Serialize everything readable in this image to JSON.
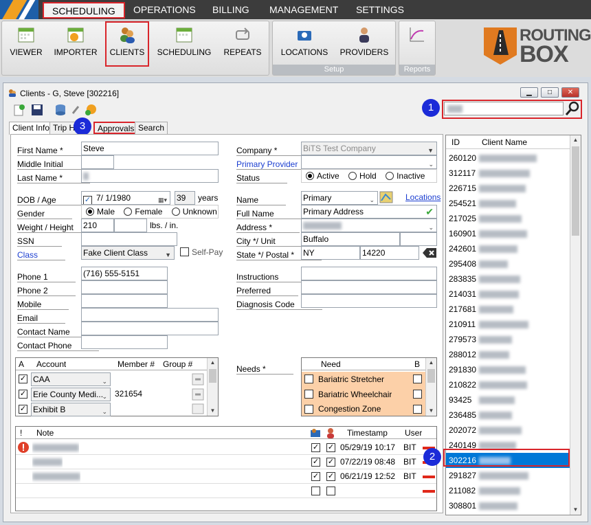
{
  "menu": {
    "items": [
      "SCHEDULING",
      "OPERATIONS",
      "BILLING",
      "MANAGEMENT",
      "SETTINGS"
    ]
  },
  "ribbon": {
    "buttons": [
      "VIEWER",
      "IMPORTER",
      "CLIENTS",
      "SCHEDULING",
      "REPEATS",
      "LOCATIONS",
      "PROVIDERS"
    ],
    "groups": [
      "Setup",
      "Reports"
    ],
    "brand_top": "ROUTING",
    "brand_bottom": "BOX"
  },
  "window": {
    "title": "Clients - G, Steve [302216]",
    "minimize": "▁",
    "restore": "□",
    "close": "✕"
  },
  "tabs": [
    "Client Info",
    "Trip H",
    "Approvals",
    "Search"
  ],
  "badges": [
    "1",
    "2",
    "3"
  ],
  "form": {
    "first_name_label": "First Name *",
    "first_name": "Steve",
    "middle_initial_label": "Middle Initial",
    "last_name_label": "Last Name *",
    "dob_label": "DOB / Age",
    "dob": "7/ 1/1980",
    "age": "39",
    "years": "years",
    "gender_label": "Gender",
    "gender_options": [
      "Male",
      "Female",
      "Unknown"
    ],
    "weight_label": "Weight / Height",
    "weight": "210",
    "weight_units": "lbs. / in.",
    "ssn_label": "SSN",
    "class_label": "Class",
    "class_value": "Fake Client Class",
    "self_pay": "Self-Pay",
    "phone1_label": "Phone 1",
    "phone1": "(716) 555-5151",
    "phone2_label": "Phone 2",
    "mobile_label": "Mobile",
    "email_label": "Email",
    "contact_name_label": "Contact Name",
    "contact_phone_label": "Contact Phone",
    "company_label": "Company *",
    "company": "BiTS Test Company",
    "primary_provider_label": "Primary Provider",
    "status_label": "Status",
    "status_options": [
      "Active",
      "Hold",
      "Inactive"
    ],
    "name_label": "Name",
    "name_value": "Primary",
    "locations_link": "Locations",
    "full_name_label": "Full Name",
    "full_name": "Primary Address",
    "address_label": "Address *",
    "city_label": "City */ Unit",
    "city": "Buffalo",
    "state_label": "State */ Postal *",
    "state": "NY",
    "postal": "14220",
    "instructions_label": "Instructions",
    "preferred_label": "Preferred",
    "diagnosis_label": "Diagnosis Code",
    "needs_label": "Needs *"
  },
  "accounts": {
    "headers": [
      "A",
      "Account",
      "Member #",
      "Group #"
    ],
    "rows": [
      {
        "account": "CAA",
        "member": ""
      },
      {
        "account": "Erie County Medi...",
        "member": "321654"
      },
      {
        "account": "Exhibit B",
        "member": ""
      }
    ]
  },
  "needs": {
    "headers": [
      "Need",
      "B"
    ],
    "rows": [
      "Bariatric Stretcher",
      "Bariatric Wheelchair",
      "Congestion Zone"
    ]
  },
  "notes": {
    "headers": [
      "!",
      "Note",
      "Timestamp",
      "User"
    ],
    "rows": [
      {
        "ts": "05/29/19 10:17",
        "user": "BIT"
      },
      {
        "ts": "07/22/19 08:48",
        "user": "BIT"
      },
      {
        "ts": "06/21/19 12:52",
        "user": "BIT"
      }
    ]
  },
  "client_list": {
    "headers": [
      "ID",
      "Client Name"
    ],
    "ids": [
      "260120",
      "312117",
      "226715",
      "254521",
      "217025",
      "160901",
      "242601",
      "295408",
      "283835",
      "214031",
      "217681",
      "210911",
      "279573",
      "288012",
      "291830",
      "210822",
      "93425",
      "236485",
      "202072",
      "240149",
      "302216",
      "291827",
      "211082",
      "308801"
    ],
    "selected_index": 20
  },
  "colors": {
    "accent_red": "#d9242a",
    "badge_blue": "#1b2bd8",
    "selection": "#0078d7",
    "need_orange": "#fcd0a8"
  }
}
